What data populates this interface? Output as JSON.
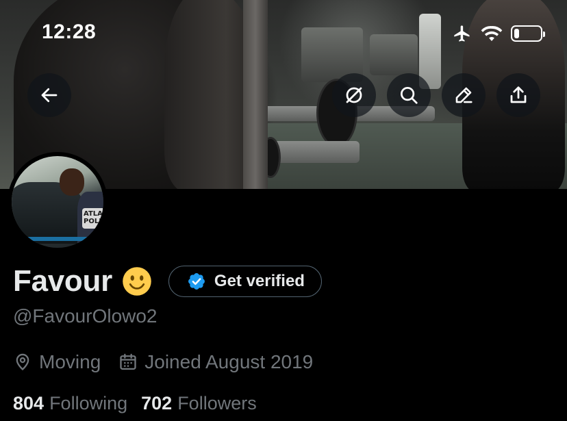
{
  "status_bar": {
    "time": "12:28",
    "icons": [
      "airplane-icon",
      "wifi-icon",
      "battery-icon"
    ],
    "battery_level": 0.2
  },
  "nav": {
    "back_icon": "arrow-left-icon",
    "actions": [
      "grok-icon",
      "search-icon",
      "edit-icon",
      "share-icon"
    ]
  },
  "profile": {
    "display_name": "Favour",
    "emoji": "slightly-smiling-face",
    "verify_button_label": "Get verified",
    "handle": "@FavourOlowo2",
    "location": "Moving",
    "joined": "Joined August 2019",
    "following_count": "804",
    "following_label": "Following",
    "followers_count": "702",
    "followers_label": "Followers",
    "avatar_patch_text": "ATLAN POLI"
  },
  "colors": {
    "background": "#000000",
    "primary_text": "#e7e9ea",
    "secondary_text": "#71767b",
    "verified_blue": "#1d9bf0",
    "button_border": "#536471"
  }
}
